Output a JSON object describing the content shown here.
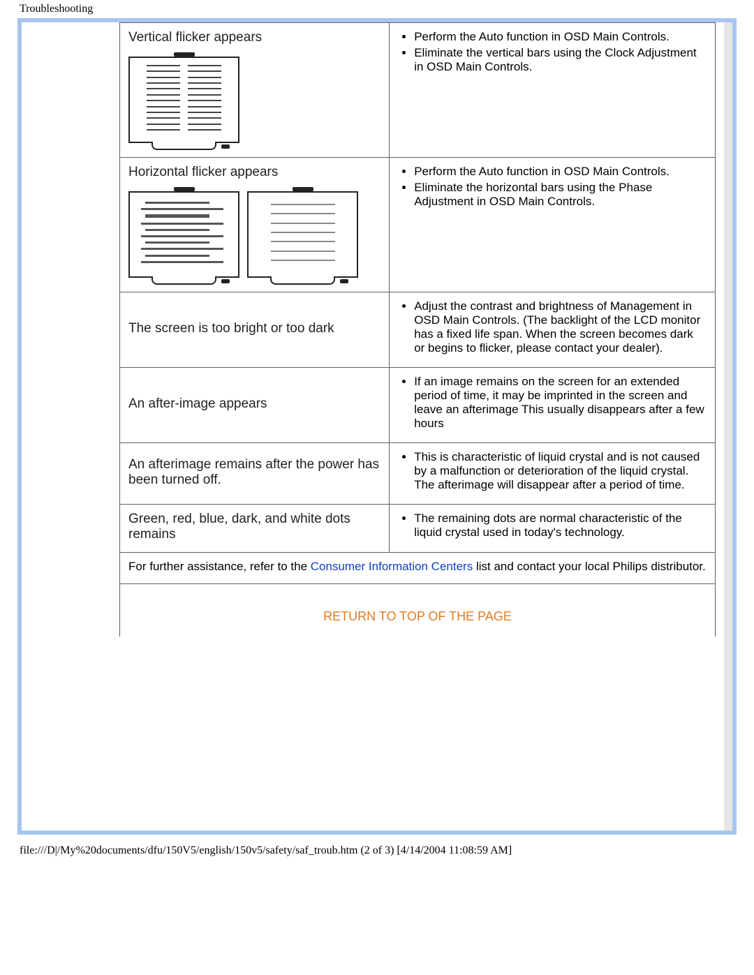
{
  "header": {
    "title": "Troubleshooting"
  },
  "rows": [
    {
      "title": "Vertical flicker appears",
      "solutions": [
        "Perform the Auto function in OSD Main Controls.",
        "Eliminate the vertical bars using the Clock Adjustment in OSD Main Controls."
      ]
    },
    {
      "title": "Horizontal flicker appears",
      "solutions": [
        "Perform the Auto function in OSD Main Controls.",
        "Eliminate the horizontal bars using the Phase Adjustment in OSD Main Controls."
      ]
    },
    {
      "title": "The screen is too bright or too dark",
      "solutions": [
        "Adjust the contrast and brightness of Management in OSD Main Controls. (The backlight of the LCD monitor has a fixed life span. When the screen becomes dark or begins to flicker, please contact your dealer)."
      ]
    },
    {
      "title": "An after-image appears",
      "solutions": [
        "If an image remains on the screen for an extended period of time, it may be imprinted in the screen and leave an afterimage This usually disappears after a few hours"
      ]
    },
    {
      "title": "An afterimage remains after the power has been turned off.",
      "solutions": [
        "This is characteristic of liquid crystal and is not caused by a malfunction or deterioration of the liquid crystal. The afterimage will disappear after a period of time."
      ]
    },
    {
      "title": "Green, red, blue, dark, and white dots remains",
      "solutions": [
        "The remaining dots are normal characteristic of the liquid crystal used in today's technology."
      ]
    }
  ],
  "footer": {
    "before": "For further assistance, refer to the ",
    "link_text": "Consumer Information Centers",
    "after": " list and contact your local Philips distributor."
  },
  "return_link": "RETURN TO TOP OF THE PAGE",
  "file_line": "file:///D|/My%20documents/dfu/150V5/english/150v5/safety/saf_troub.htm (2 of 3) [4/14/2004 11:08:59 AM]"
}
